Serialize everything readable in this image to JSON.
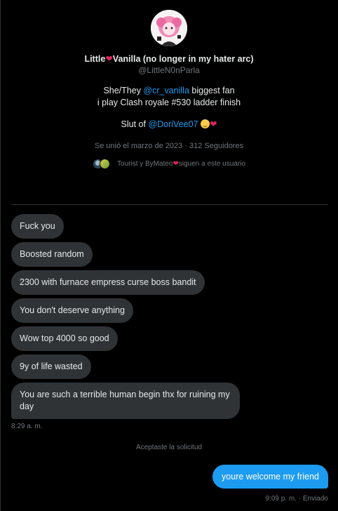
{
  "profile": {
    "name_prefix": "Little",
    "name_suffix": "Vanilla (no longer in my hater arc)",
    "handle": "@LittleN0nParla",
    "bio_prefix": "She/They ",
    "bio_mention": "@cr_vanilla",
    "bio_suffix": " biggest fan",
    "bio_line2": "i play Clash royale #530 ladder finish",
    "bio_line3_prefix": "Slut of ",
    "bio_line3_mention": "@DoriVee07",
    "joined": "Se unió el marzo de 2023 · 312 Seguidores",
    "followed_by": "Tourist y ByMateo",
    "followed_by_suffix": " siguen a este usuario"
  },
  "conversation": {
    "received": [
      "Fuck you",
      "Boosted random",
      "2300 with furnace empress curse boss bandit",
      "You don't deserve anything",
      "Wow top 4000 so good",
      "9y of life wasted",
      "You are such a terrible human begin thx for ruining my day"
    ],
    "received_time": "8:29 a. m.",
    "request_notice": "Aceptaste la solicitud",
    "sent_message": "youre welcome my friend",
    "sent_meta": "9:09 p. m. · Enviado"
  },
  "colors": {
    "background": "#000000",
    "bubble_received": "#2f3336",
    "bubble_sent": "#1d9bf0",
    "mention": "#1d9bf0",
    "muted": "#71767b"
  },
  "icons": [
    "heart-icon",
    "smiling-face-with-hearts-icon",
    "avatar"
  ]
}
